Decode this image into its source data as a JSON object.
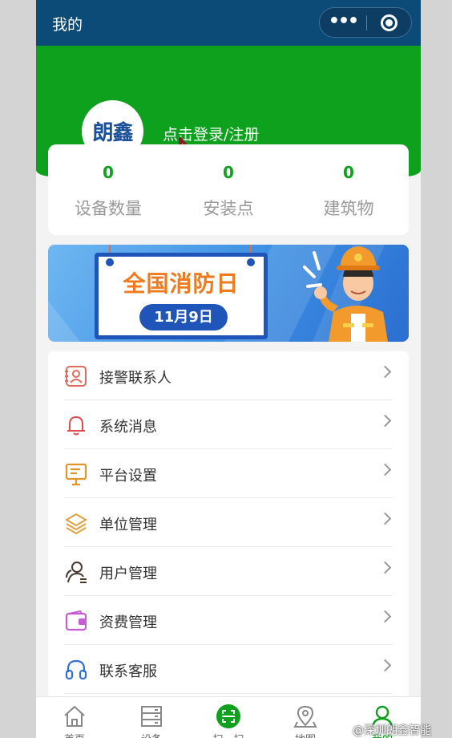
{
  "navbar": {
    "title": "我的",
    "more_icon": "more-dots-icon",
    "close_icon": "target-icon"
  },
  "header": {
    "logo_text_1": "朗",
    "logo_text_2": "鑫",
    "login_text": "点击登录/注册",
    "accent": "#0ea11d"
  },
  "stats": [
    {
      "value": "0",
      "label": "设备数量"
    },
    {
      "value": "0",
      "label": "安装点"
    },
    {
      "value": "0",
      "label": "建筑物"
    }
  ],
  "banner": {
    "title": "全国消防日",
    "date": "11月9日"
  },
  "menu": [
    {
      "label": "接警联系人",
      "icon": "contact-card-icon"
    },
    {
      "label": "系统消息",
      "icon": "bell-icon"
    },
    {
      "label": "平台设置",
      "icon": "presentation-board-icon"
    },
    {
      "label": "单位管理",
      "icon": "layers-icon"
    },
    {
      "label": "用户管理",
      "icon": "users-icon"
    },
    {
      "label": "资费管理",
      "icon": "wallet-icon"
    },
    {
      "label": "联系客服",
      "icon": "headset-icon"
    }
  ],
  "tabbar": [
    {
      "label": "首页",
      "icon": "home-icon"
    },
    {
      "label": "设备",
      "icon": "server-icon"
    },
    {
      "label": "扫一扫",
      "icon": "scan-icon"
    },
    {
      "label": "地图",
      "icon": "map-pin-icon"
    },
    {
      "label": "我的",
      "icon": "user-icon",
      "active": true
    }
  ],
  "watermark": "@深圳朗鑫智能"
}
